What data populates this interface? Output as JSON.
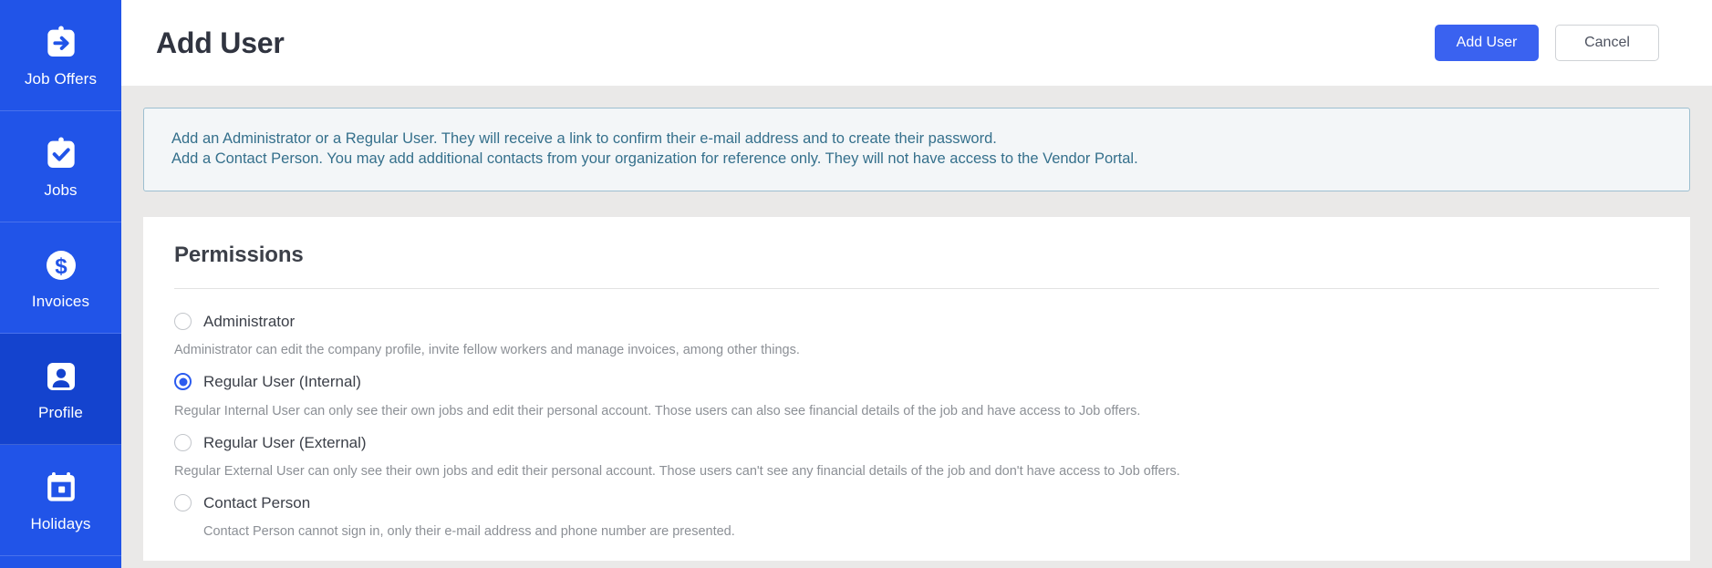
{
  "theme": {
    "sidebar_bg": "#2154E8",
    "sidebar_active_bg": "#1443CE",
    "primary_button": "#3A62F0",
    "page_bg": "#EAE9E8",
    "notice_bg": "#F3F6F8",
    "notice_border": "#9DBFD0",
    "notice_text": "#35708C",
    "radio_checked": "#2B5BEF"
  },
  "sidebar": {
    "items": [
      {
        "label": "Job Offers",
        "icon": "clipboard-arrow-icon",
        "active": false
      },
      {
        "label": "Jobs",
        "icon": "clipboard-check-icon",
        "active": false
      },
      {
        "label": "Invoices",
        "icon": "dollar-circle-icon",
        "active": false
      },
      {
        "label": "Profile",
        "icon": "user-icon",
        "active": true
      },
      {
        "label": "Holidays",
        "icon": "calendar-icon",
        "active": false
      }
    ]
  },
  "header": {
    "title": "Add User",
    "add_user_label": "Add User",
    "cancel_label": "Cancel"
  },
  "notice": {
    "line1": "Add an Administrator or a Regular User. They will receive a link to confirm their e-mail address and to create their password.",
    "line2": "Add a Contact Person. You may add additional contacts from your organization for reference only. They will not have access to the Vendor Portal."
  },
  "permissions": {
    "title": "Permissions",
    "options": [
      {
        "label": "Administrator",
        "selected": false,
        "description": "Administrator can edit the company profile, invite fellow workers and manage invoices, among other things.",
        "indent_description": false
      },
      {
        "label": "Regular User (Internal)",
        "selected": true,
        "description": "Regular Internal User can only see their own jobs and edit their personal account. Those users can also see financial details of the job and have access to Job offers.",
        "indent_description": false
      },
      {
        "label": "Regular User (External)",
        "selected": false,
        "description": "Regular External User can only see their own jobs and edit their personal account. Those users can't see any financial details of the job and don't have access to Job offers.",
        "indent_description": false
      },
      {
        "label": "Contact Person",
        "selected": false,
        "description": "Contact Person cannot sign in, only their e-mail address and phone number are presented.",
        "indent_description": true
      }
    ]
  }
}
